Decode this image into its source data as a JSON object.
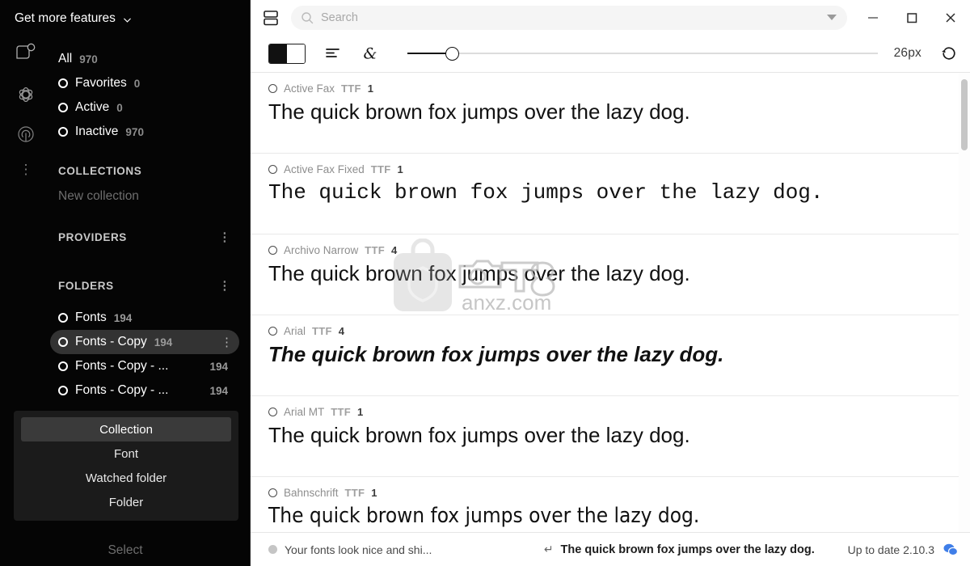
{
  "sidebar": {
    "get_more": {
      "label": "Get more features",
      "icon": "chevron-down-icon"
    },
    "rail_icons": [
      "tag-icon",
      "atom-icon",
      "broadcast-icon",
      "kebab-menu-icon"
    ],
    "filters": [
      {
        "label": "All",
        "count": "970",
        "icon": ""
      },
      {
        "label": "Favorites",
        "count": "0",
        "icon": "ring-icon"
      },
      {
        "label": "Active",
        "count": "0",
        "icon": "ring-icon"
      },
      {
        "label": "Inactive",
        "count": "970",
        "icon": "ring-icon"
      }
    ],
    "collections": {
      "title": "COLLECTIONS",
      "new_label": "New collection"
    },
    "providers": {
      "title": "PROVIDERS",
      "menu_icon": "kebab-menu-icon"
    },
    "folders": {
      "title": "FOLDERS",
      "menu_icon": "kebab-menu-icon",
      "items": [
        {
          "label": "Fonts",
          "count": "194",
          "active": false
        },
        {
          "label": "Fonts - Copy",
          "count": "194",
          "active": true
        },
        {
          "label": "Fonts - Copy - ...",
          "count": "194",
          "active": false
        },
        {
          "label": "Fonts - Copy - ...",
          "count": "194",
          "active": false
        }
      ]
    },
    "context_menu": {
      "items": [
        {
          "label": "Collection",
          "selected": true
        },
        {
          "label": "Font",
          "selected": false
        },
        {
          "label": "Watched folder",
          "selected": false
        },
        {
          "label": "Folder",
          "selected": false
        }
      ]
    },
    "select_label": "Select"
  },
  "titlebar": {
    "panel_icon": "panel-layout-icon",
    "search": {
      "placeholder": "Search",
      "value": "",
      "icon": "search-icon"
    },
    "dropdown_icon": "caret-down-icon",
    "minimize_label": "–",
    "maximize_label": "□",
    "close_label": "✕"
  },
  "toolbar": {
    "bw_toggle_name": "black-white-toggle",
    "align_icon": "text-align-left-icon",
    "ampersand_icon": "ampersand-glyph-icon",
    "size_slider": {
      "value": 26,
      "min": 8,
      "max": 220,
      "percent": 8.1
    },
    "size_label": "26px",
    "reset_icon": "reset-rotate-icon"
  },
  "fonts": [
    {
      "name": "Active Fax",
      "ext": "TTF",
      "count": "1",
      "sample": "The quick brown fox jumps over the lazy dog.",
      "style": "s-sans"
    },
    {
      "name": "Active Fax Fixed",
      "ext": "TTF",
      "count": "1",
      "sample": "The quick brown fox jumps over the lazy dog.",
      "style": "s-mono"
    },
    {
      "name": "Archivo Narrow",
      "ext": "TTF",
      "count": "4",
      "sample": "The quick brown fox jumps over the lazy dog.",
      "style": "s-narrow"
    },
    {
      "name": "Arial",
      "ext": "TTF",
      "count": "4",
      "sample": "The quick brown fox jumps over the lazy dog.",
      "style": "s-bolditalic"
    },
    {
      "name": "Arial MT",
      "ext": "TTF",
      "count": "1",
      "sample": "The quick brown fox jumps over the lazy dog.",
      "style": "s-sans"
    },
    {
      "name": "Bahnschrift",
      "ext": "TTF",
      "count": "1",
      "sample": "The quick brown fox jumps over the lazy dog.",
      "style": "s-cond"
    }
  ],
  "watermark": {
    "text": "anxz.com",
    "logo": "shield-bag-icon"
  },
  "status": {
    "left_text": "Your fonts look nice and shi...",
    "enter_symbol": "↵",
    "center_text": "The quick brown fox jumps over the lazy dog.",
    "version_text": "Up to date 2.10.3",
    "chat_icon": "chat-bubble-icon"
  },
  "colors": {
    "sidebar_bg": "#050505",
    "accent_blue": "#3f7ee8",
    "selected_row": "#333333",
    "main_bg": "#ffffff"
  }
}
